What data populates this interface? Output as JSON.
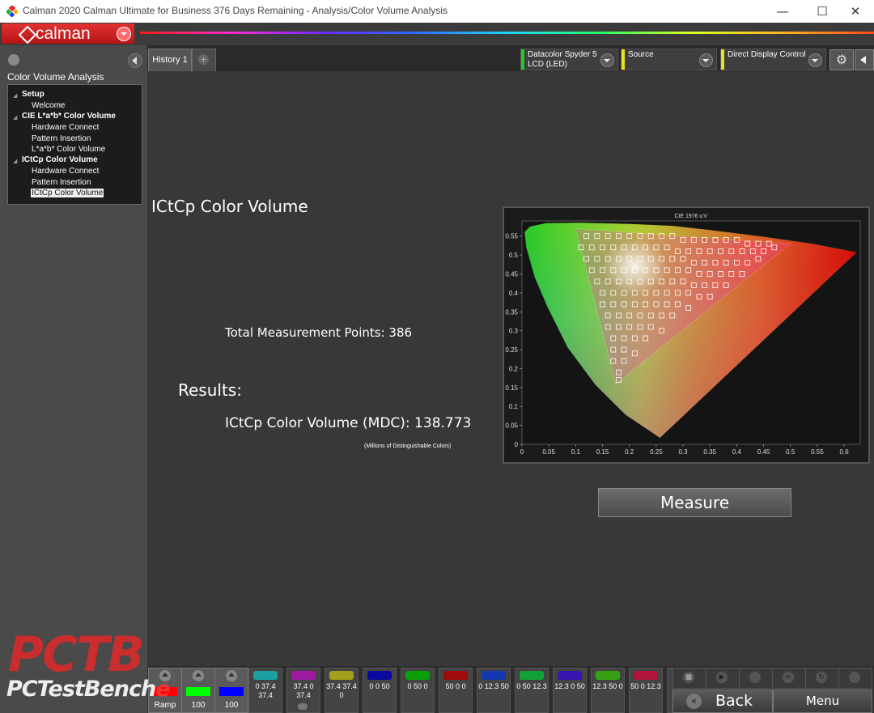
{
  "window": {
    "title": "Calman 2020 Calman Ultimate for Business 376 Days Remaining - Analysis/Color Volume Analysis",
    "minimize": "—",
    "maximize": "☐",
    "close": "✕"
  },
  "brand": {
    "logo_text": "calman"
  },
  "sidebar": {
    "title": "Color Volume Analysis",
    "tree": [
      {
        "label": "Setup",
        "group": true
      },
      {
        "label": "Welcome"
      },
      {
        "label": "CIE L*a*b* Color Volume",
        "group": true
      },
      {
        "label": "Hardware Connect"
      },
      {
        "label": "Pattern Insertion"
      },
      {
        "label": "L*a*b* Color Volume"
      },
      {
        "label": "ICtCp Color Volume",
        "group": true
      },
      {
        "label": "Hardware Connect"
      },
      {
        "label": "Pattern Insertion"
      },
      {
        "label": "ICtCp Color Volume",
        "selected": true
      }
    ]
  },
  "tabs": {
    "history": "History 1",
    "add": "+"
  },
  "toolbar": {
    "meter": {
      "line1": "Datacolor Spyder 5",
      "line2": "LCD (LED)",
      "color": "#22cc22"
    },
    "source": {
      "label": "Source",
      "color": "#e8e020"
    },
    "display": {
      "label": "Direct Display Control",
      "color": "#e8e020"
    },
    "settings_icon": "gear-icon",
    "gear_glyph": "⚙"
  },
  "main": {
    "title": "ICtCp Color Volume",
    "total_points": "Total Measurement Points: 386",
    "results_label": "Results:",
    "volume": "ICtCp Color Volume (MDC): 138.773",
    "volume_note": "(Millions of Distinguishable  Colors)",
    "measure_button": "Measure"
  },
  "chart_data": {
    "type": "scatter",
    "title": "CIE 1976 u'v'",
    "xlabel": "",
    "ylabel": "",
    "xlim": [
      0,
      0.63
    ],
    "ylim": [
      0,
      0.59
    ],
    "x_ticks": [
      "0",
      "0.05",
      "0.1",
      "0.15",
      "0.2",
      "0.25",
      "0.3",
      "0.35",
      "0.4",
      "0.45",
      "0.5",
      "0.55",
      "0.6"
    ],
    "y_ticks": [
      "0",
      "0.05",
      "0.1",
      "0.15",
      "0.2",
      "0.25",
      "0.3",
      "0.35",
      "0.4",
      "0.45",
      "0.5",
      "0.55"
    ],
    "grid": false,
    "spectral_locus": [
      [
        0.257,
        0.017
      ],
      [
        0.193,
        0.078
      ],
      [
        0.137,
        0.157
      ],
      [
        0.085,
        0.256
      ],
      [
        0.048,
        0.362
      ],
      [
        0.024,
        0.441
      ],
      [
        0.008,
        0.521
      ],
      [
        0.005,
        0.561
      ],
      [
        0.015,
        0.575
      ],
      [
        0.045,
        0.584
      ],
      [
        0.11,
        0.585
      ],
      [
        0.2,
        0.582
      ],
      [
        0.28,
        0.577
      ],
      [
        0.35,
        0.566
      ],
      [
        0.45,
        0.548
      ],
      [
        0.54,
        0.53
      ],
      [
        0.623,
        0.507
      ]
    ],
    "gamut_triangle": {
      "red": [
        0.5,
        0.53
      ],
      "green": [
        0.1,
        0.57
      ],
      "blue": [
        0.175,
        0.16
      ]
    },
    "measurements": [
      [
        0.12,
        0.55
      ],
      [
        0.14,
        0.55
      ],
      [
        0.16,
        0.55
      ],
      [
        0.18,
        0.55
      ],
      [
        0.2,
        0.55
      ],
      [
        0.22,
        0.55
      ],
      [
        0.24,
        0.55
      ],
      [
        0.26,
        0.55
      ],
      [
        0.28,
        0.55
      ],
      [
        0.3,
        0.54
      ],
      [
        0.32,
        0.54
      ],
      [
        0.34,
        0.54
      ],
      [
        0.36,
        0.54
      ],
      [
        0.38,
        0.54
      ],
      [
        0.4,
        0.54
      ],
      [
        0.42,
        0.53
      ],
      [
        0.44,
        0.53
      ],
      [
        0.46,
        0.53
      ],
      [
        0.11,
        0.52
      ],
      [
        0.13,
        0.52
      ],
      [
        0.15,
        0.52
      ],
      [
        0.17,
        0.52
      ],
      [
        0.19,
        0.52
      ],
      [
        0.21,
        0.52
      ],
      [
        0.23,
        0.52
      ],
      [
        0.25,
        0.52
      ],
      [
        0.27,
        0.52
      ],
      [
        0.29,
        0.51
      ],
      [
        0.31,
        0.51
      ],
      [
        0.33,
        0.51
      ],
      [
        0.35,
        0.51
      ],
      [
        0.37,
        0.51
      ],
      [
        0.39,
        0.51
      ],
      [
        0.41,
        0.51
      ],
      [
        0.43,
        0.51
      ],
      [
        0.45,
        0.51
      ],
      [
        0.47,
        0.52
      ],
      [
        0.12,
        0.49
      ],
      [
        0.14,
        0.49
      ],
      [
        0.16,
        0.49
      ],
      [
        0.18,
        0.49
      ],
      [
        0.2,
        0.49
      ],
      [
        0.22,
        0.49
      ],
      [
        0.24,
        0.49
      ],
      [
        0.26,
        0.49
      ],
      [
        0.28,
        0.49
      ],
      [
        0.3,
        0.49
      ],
      [
        0.32,
        0.48
      ],
      [
        0.34,
        0.48
      ],
      [
        0.36,
        0.48
      ],
      [
        0.38,
        0.48
      ],
      [
        0.4,
        0.48
      ],
      [
        0.42,
        0.48
      ],
      [
        0.44,
        0.49
      ],
      [
        0.13,
        0.46
      ],
      [
        0.15,
        0.46
      ],
      [
        0.17,
        0.46
      ],
      [
        0.19,
        0.46
      ],
      [
        0.21,
        0.46
      ],
      [
        0.23,
        0.46
      ],
      [
        0.25,
        0.46
      ],
      [
        0.27,
        0.46
      ],
      [
        0.29,
        0.46
      ],
      [
        0.31,
        0.46
      ],
      [
        0.33,
        0.45
      ],
      [
        0.35,
        0.45
      ],
      [
        0.37,
        0.45
      ],
      [
        0.39,
        0.45
      ],
      [
        0.41,
        0.45
      ],
      [
        0.14,
        0.43
      ],
      [
        0.16,
        0.43
      ],
      [
        0.18,
        0.43
      ],
      [
        0.2,
        0.43
      ],
      [
        0.22,
        0.43
      ],
      [
        0.24,
        0.43
      ],
      [
        0.26,
        0.43
      ],
      [
        0.28,
        0.43
      ],
      [
        0.3,
        0.43
      ],
      [
        0.32,
        0.42
      ],
      [
        0.34,
        0.42
      ],
      [
        0.36,
        0.42
      ],
      [
        0.38,
        0.42
      ],
      [
        0.15,
        0.4
      ],
      [
        0.17,
        0.4
      ],
      [
        0.19,
        0.4
      ],
      [
        0.21,
        0.4
      ],
      [
        0.23,
        0.4
      ],
      [
        0.25,
        0.4
      ],
      [
        0.27,
        0.4
      ],
      [
        0.29,
        0.4
      ],
      [
        0.31,
        0.4
      ],
      [
        0.33,
        0.39
      ],
      [
        0.35,
        0.39
      ],
      [
        0.15,
        0.37
      ],
      [
        0.17,
        0.37
      ],
      [
        0.19,
        0.37
      ],
      [
        0.21,
        0.37
      ],
      [
        0.23,
        0.37
      ],
      [
        0.25,
        0.37
      ],
      [
        0.27,
        0.37
      ],
      [
        0.29,
        0.37
      ],
      [
        0.31,
        0.36
      ],
      [
        0.16,
        0.34
      ],
      [
        0.18,
        0.34
      ],
      [
        0.2,
        0.34
      ],
      [
        0.22,
        0.34
      ],
      [
        0.24,
        0.34
      ],
      [
        0.26,
        0.34
      ],
      [
        0.28,
        0.34
      ],
      [
        0.16,
        0.31
      ],
      [
        0.18,
        0.31
      ],
      [
        0.2,
        0.31
      ],
      [
        0.22,
        0.31
      ],
      [
        0.24,
        0.31
      ],
      [
        0.26,
        0.3
      ],
      [
        0.17,
        0.28
      ],
      [
        0.19,
        0.28
      ],
      [
        0.21,
        0.28
      ],
      [
        0.23,
        0.28
      ],
      [
        0.17,
        0.25
      ],
      [
        0.19,
        0.25
      ],
      [
        0.21,
        0.24
      ],
      [
        0.17,
        0.22
      ],
      [
        0.19,
        0.22
      ],
      [
        0.18,
        0.19
      ],
      [
        0.18,
        0.17
      ]
    ]
  },
  "patterns": [
    {
      "color": "#1aa0a0",
      "label": "0 37.4 37.4"
    },
    {
      "color": "#a01aa0",
      "label": "37.4 0 37.4"
    },
    {
      "color": "#a0a01a",
      "label": "37.4 37.4 0"
    },
    {
      "color": "#0a0aa0",
      "label": "0 0 50"
    },
    {
      "color": "#0aa00a",
      "label": "0 50 0"
    },
    {
      "color": "#a00a0a",
      "label": "50 0 0"
    },
    {
      "color": "#1438b0",
      "label": "0 12.3 50"
    },
    {
      "color": "#14a038",
      "label": "0 50 12.3"
    },
    {
      "color": "#3814b0",
      "label": "12.3 0 50"
    },
    {
      "color": "#38a014",
      "label": "12.3 50 0"
    },
    {
      "color": "#b01438",
      "label": "50 0 12.3"
    }
  ],
  "big_patterns": [
    {
      "color": "#ff0000",
      "label": "Ramp"
    },
    {
      "color": "#00ff00",
      "label": "100"
    },
    {
      "color": "#0000ff",
      "label": "100"
    }
  ],
  "controls": {
    "back": "Back",
    "back_glyph": "«",
    "menu": "Menu",
    "stop_glyph": "■",
    "play_glyph": "▶",
    "loop_glyph": "∞",
    "refresh_glyph": "↻"
  },
  "watermark": {
    "big": "PCTB",
    "small": "PCTestBench",
    "small_e": "e"
  }
}
